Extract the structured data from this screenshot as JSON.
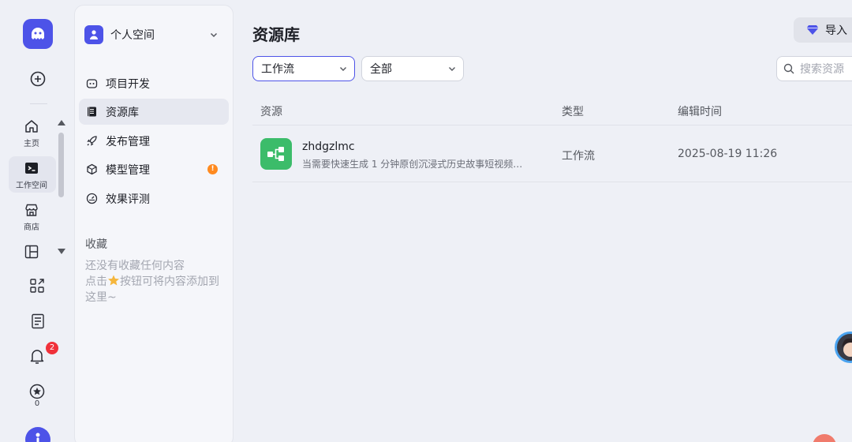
{
  "rail": {
    "home_label": "主页",
    "workspace_label": "工作空间",
    "store_label": "商店",
    "notification_count": "2",
    "favorites_count": "0"
  },
  "sidebar": {
    "space_name": "个人空间",
    "nav": [
      {
        "label": "项目开发"
      },
      {
        "label": "资源库"
      },
      {
        "label": "发布管理"
      },
      {
        "label": "模型管理",
        "dot": "!"
      },
      {
        "label": "效果评测"
      }
    ],
    "favorites_title": "收藏",
    "favorites_empty_line1": "还没有收藏任何内容",
    "favorites_empty_line2_prefix": "点击",
    "favorites_empty_line2_suffix": "按钮可将内容添加到",
    "favorites_empty_line3": "这里~"
  },
  "main": {
    "title": "资源库",
    "import_label": "导入",
    "filter_type": "工作流",
    "filter_scope": "全部",
    "search_placeholder": "搜索资源",
    "columns": [
      "资源",
      "类型",
      "编辑时间"
    ],
    "rows": [
      {
        "name": "zhdgzlmc",
        "description": "当需要快速生成 1 分钟原创沉浸式历史故事短视频…",
        "type": "工作流",
        "edited": "2025-08-19 11:26"
      }
    ]
  },
  "colors": {
    "brand": "#4d53e8",
    "workflow_icon": "#3cbc6a",
    "badge_red": "#f0313a",
    "badge_orange": "#ff8a1f"
  }
}
